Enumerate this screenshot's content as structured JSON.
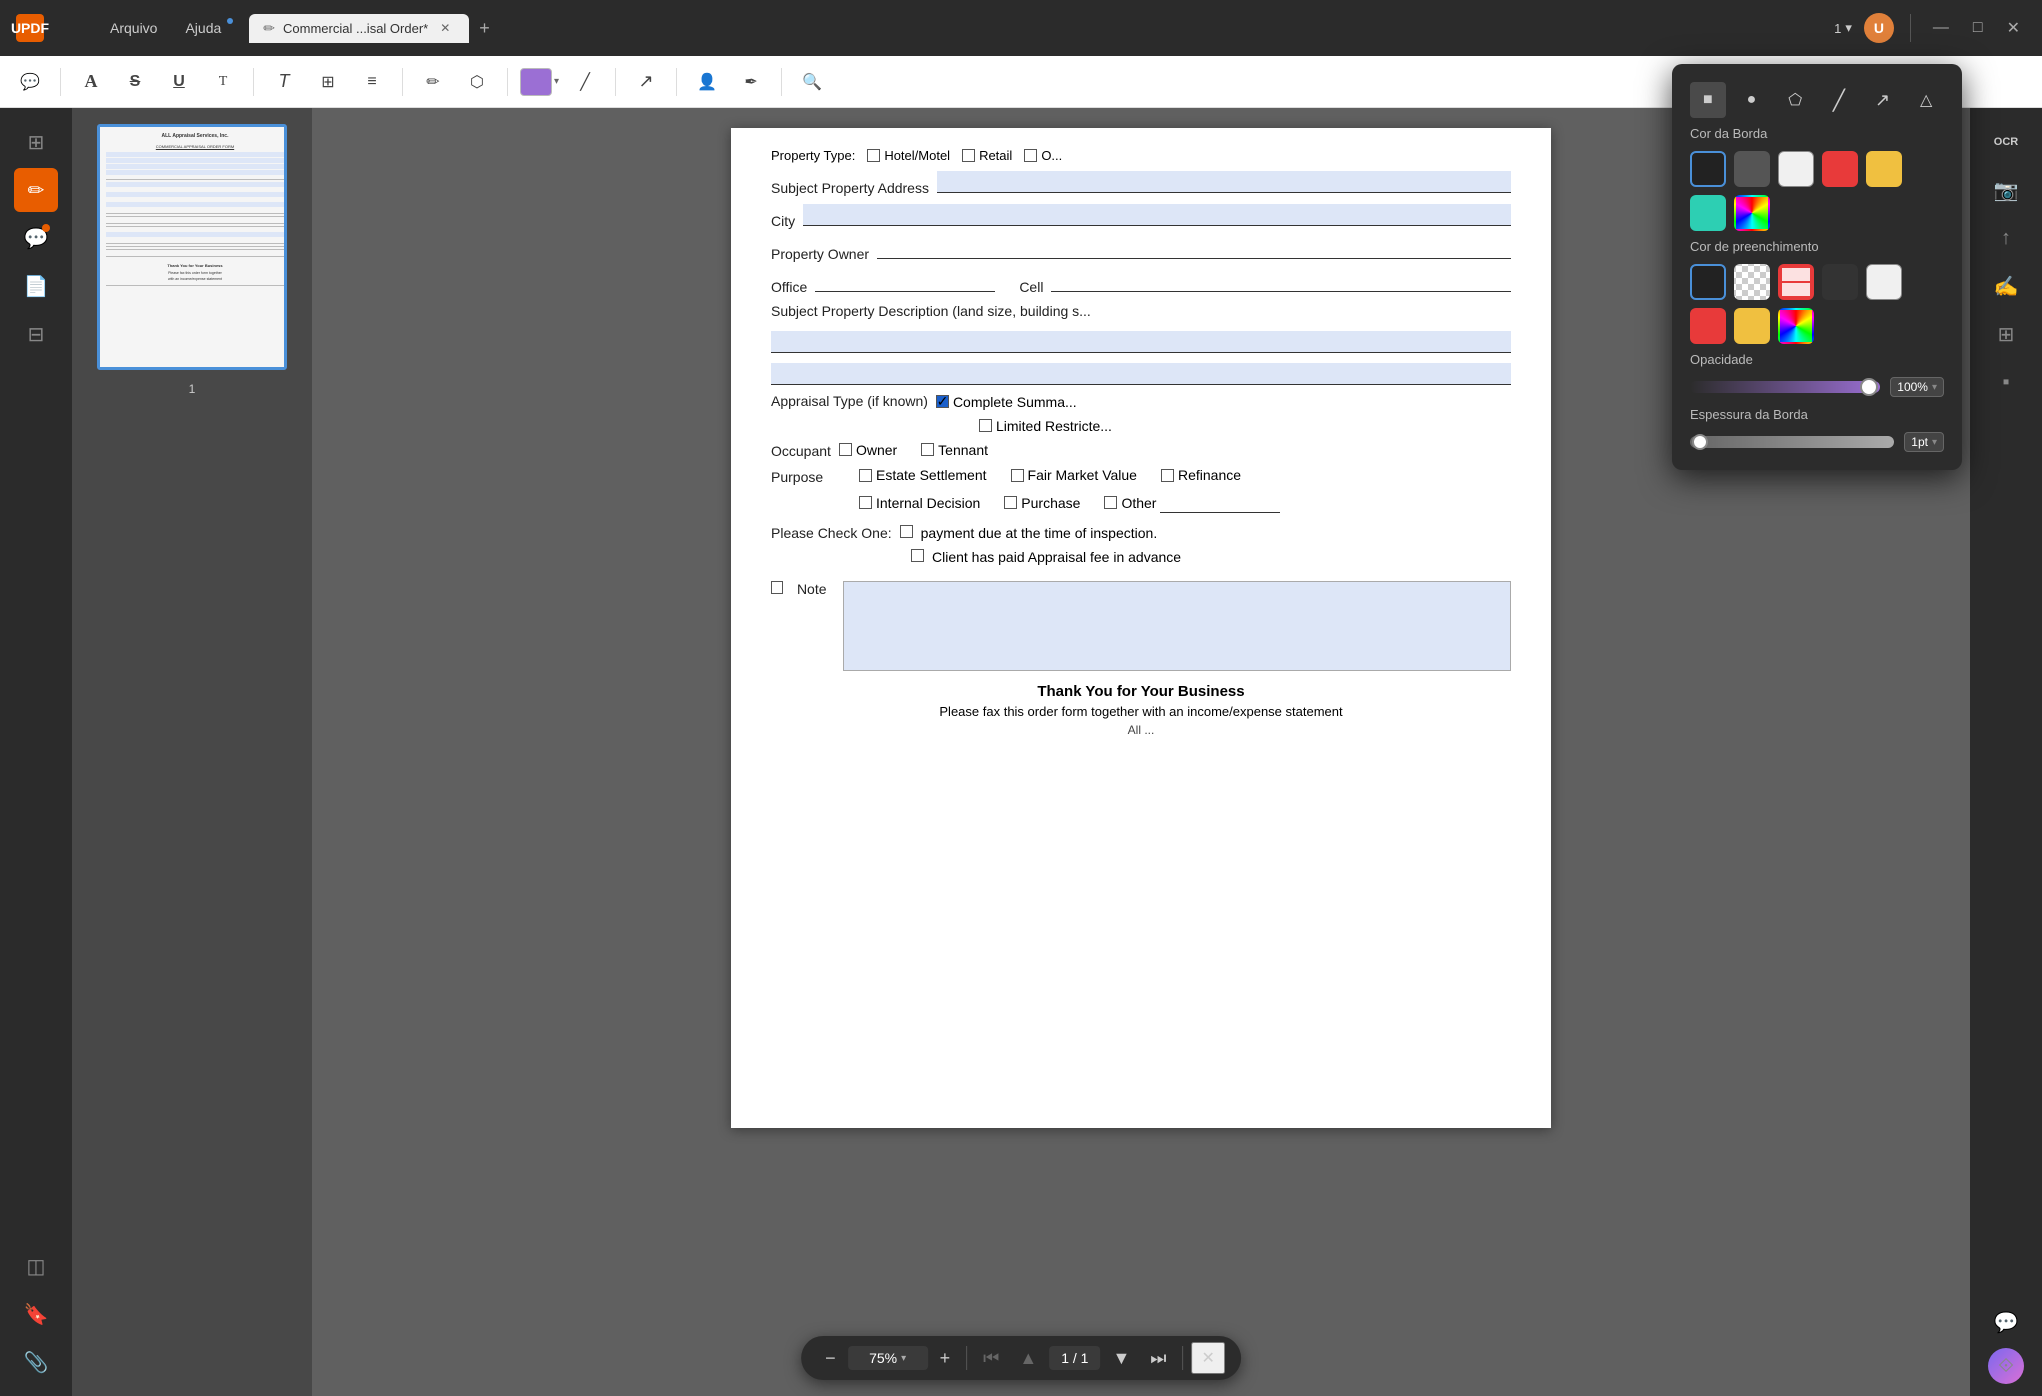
{
  "app": {
    "name": "UPDF",
    "logo_text": "UPDF"
  },
  "topbar": {
    "menu_items": [
      "Arquivo",
      "Ajuda"
    ],
    "tab_title": "Commercial ...isal Order*",
    "tab_icon": "document-icon",
    "add_tab_label": "+",
    "page_indicator": "1",
    "page_chevron": "▾",
    "window_buttons": [
      "—",
      "□",
      "✕"
    ]
  },
  "toolbar": {
    "tools": [
      {
        "name": "comment",
        "icon": "💬"
      },
      {
        "name": "highlight",
        "icon": "A"
      },
      {
        "name": "strikethrough",
        "icon": "S"
      },
      {
        "name": "underline",
        "icon": "U"
      },
      {
        "name": "text-replace",
        "icon": "T"
      },
      {
        "name": "text-edit",
        "icon": "T"
      },
      {
        "name": "text-box",
        "icon": "⊞"
      },
      {
        "name": "list",
        "icon": "≡"
      },
      {
        "name": "pen",
        "icon": "✏"
      },
      {
        "name": "shape",
        "icon": "◻"
      },
      {
        "name": "color",
        "icon": "🎨"
      },
      {
        "name": "arrow",
        "icon": "↗"
      },
      {
        "name": "person",
        "icon": "👤"
      },
      {
        "name": "stamp",
        "icon": "🖊"
      },
      {
        "name": "search",
        "icon": "🔍"
      }
    ],
    "selected_color": "#9b6fd4",
    "color_arrow": "▾"
  },
  "left_sidebar": {
    "items": [
      {
        "name": "thumbnails",
        "icon": "⊞",
        "active": false
      },
      {
        "name": "edit",
        "icon": "✏",
        "active": true
      },
      {
        "name": "comment",
        "icon": "💬",
        "active": false,
        "has_dot": true
      },
      {
        "name": "pages",
        "icon": "📄",
        "active": false
      },
      {
        "name": "organize",
        "icon": "⊟",
        "active": false
      },
      {
        "name": "layers",
        "icon": "◫",
        "active": false
      },
      {
        "name": "bookmark",
        "icon": "🔖",
        "active": false
      },
      {
        "name": "attachment",
        "icon": "📎",
        "active": false
      }
    ]
  },
  "right_sidebar": {
    "items": [
      {
        "name": "ocr",
        "icon": "OCR"
      },
      {
        "name": "scan",
        "icon": "📷"
      },
      {
        "name": "export",
        "icon": "↑"
      },
      {
        "name": "sign",
        "icon": "✍"
      },
      {
        "name": "compress",
        "icon": "⊞"
      },
      {
        "name": "redact",
        "icon": "▪"
      },
      {
        "name": "chat",
        "icon": "💬"
      },
      {
        "name": "updf-ai",
        "icon": "⟐"
      }
    ]
  },
  "thumbnail": {
    "page_number": "1"
  },
  "pdf": {
    "property_types": [
      "Hotel/Motel",
      "Retail",
      "O..."
    ],
    "subject_property_address_label": "Subject Property Address",
    "city_label": "City",
    "property_owner_label": "Property Owner",
    "office_label": "Office",
    "cell_label": "Cell",
    "subject_property_description_label": "Subject Property Description (land size, building s...",
    "appraisal_type_label": "Appraisal Type (if known)",
    "complete_summary_label": "Complete Summa...",
    "limited_restricted_label": "Limited Restricte...",
    "occupant_label": "Occupant",
    "owner_label": "Owner",
    "tennant_label": "Tennant",
    "purpose_label": "Purpose",
    "estate_settlement_label": "Estate Settlement",
    "fair_market_value_label": "Fair Market Value",
    "refinance_label": "Refinance",
    "internal_decision_label": "Internal Decision",
    "purchase_label": "Purchase",
    "other_label": "Other",
    "payment_note_label": "Please Check One:",
    "payment_due_label": "payment due at the time of inspection.",
    "advance_payment_label": "Client has paid Appraisal fee in advance",
    "note_label": "Note",
    "thank_you_label": "Thank You for Your Business",
    "fax_note": "Please fax this order form together with an income/expense statement",
    "footer_note": "All ..."
  },
  "color_picker": {
    "title": "Cor da Borda",
    "shapes": [
      "■",
      "●",
      "⬠",
      "╱",
      "↗",
      "△"
    ],
    "border_colors": [
      {
        "name": "black-selected",
        "hex": "#1a1a1a",
        "selected": true
      },
      {
        "name": "dark-gray",
        "hex": "#555555"
      },
      {
        "name": "white",
        "hex": "#f0f0f0"
      },
      {
        "name": "red",
        "hex": "#e83a3a"
      },
      {
        "name": "yellow",
        "hex": "#f0c040"
      },
      {
        "name": "teal",
        "hex": "#2dcfb3"
      },
      {
        "name": "rainbow",
        "hex": "rainbow"
      }
    ],
    "fill_label": "Cor de preenchimento",
    "fill_colors": [
      {
        "name": "black-fill-selected",
        "hex": "#1a1a1a",
        "selected": true
      },
      {
        "name": "no-fill",
        "hex": "transparent"
      },
      {
        "name": "dark-fill",
        "hex": "#333333"
      },
      {
        "name": "white-fill",
        "hex": "#f0f0f0"
      },
      {
        "name": "red-fill",
        "hex": "#e83a3a"
      },
      {
        "name": "yellow-fill",
        "hex": "#f0c040"
      },
      {
        "name": "rainbow-fill",
        "hex": "rainbow"
      }
    ],
    "opacity_label": "Opacidade",
    "opacity_value": "100%",
    "opacity_percent": 100,
    "thickness_label": "Espessura da Borda",
    "thickness_value": "1pt"
  },
  "bottom_bar": {
    "zoom_out_label": "−",
    "zoom_level": "75%",
    "zoom_in_label": "+",
    "first_page_label": "⏮",
    "prev_page_label": "⮝",
    "page_display": "1 / 1",
    "next_page_label": "⮟",
    "last_page_label": "⏭",
    "close_label": "✕"
  }
}
